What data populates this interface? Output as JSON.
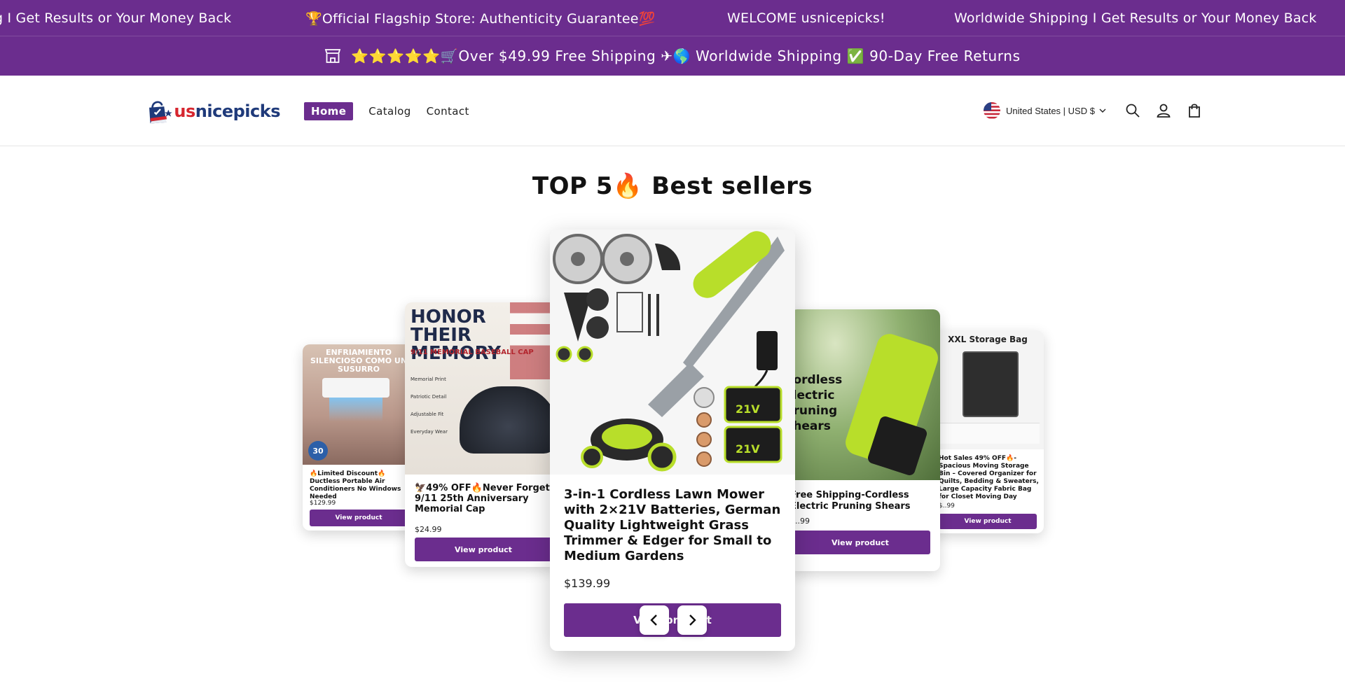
{
  "announcement": {
    "marquee": [
      "g I Get Results or Your Money Back",
      "🏆Official Flagship Store: Authenticity Guarantee💯",
      "WELCOME usnicepicks!",
      "Worldwide Shipping I Get Results or Your Money Back"
    ],
    "sub_text": "⭐⭐⭐⭐⭐🛒Over $49.99 Free Shipping ✈🌎 Worldwide Shipping ✅ 90-Day Free Returns"
  },
  "header": {
    "logo": {
      "us": "us",
      "rest": "nicepicks"
    },
    "nav": [
      "Home",
      "Catalog",
      "Contact"
    ],
    "country": "United States | USD $"
  },
  "section": {
    "title": "TOP 5🔥 Best sellers"
  },
  "products": [
    {
      "title": "🔥Limited Discount🔥Ductless Portable Air Conditioners No Windows Needed",
      "price": "$129.99",
      "button": "View product",
      "img_heading": "ENFRIAMIENTO SILENCIOSO COMO UN SUSURRO",
      "badge": "30"
    },
    {
      "title": "🦅49% OFF🔥Never Forget 9/11 25th Anniversary Memorial Cap",
      "price": "$24.99",
      "button": "View product",
      "img_heading": "HONOR THEIR MEMORY",
      "img_sub": "9/11 MEMORIAL BASEBALL CAP",
      "features": [
        "Memorial Print",
        "Patriotic Detail",
        "Adjustable Fit",
        "Everyday Wear"
      ]
    },
    {
      "title": "3-in-1 Cordless Lawn Mower with 2×21V Batteries, German Quality Lightweight Grass Trimmer & Edger for Small to Medium Gardens",
      "price": "$139.99",
      "button": "View product",
      "battery_label": "21V"
    },
    {
      "title": "Free Shipping-Cordless Electric Pruning Shears",
      "price": "$..99",
      "button": "View product",
      "img_heading": "Cordless Electric Pruning Shears"
    },
    {
      "title": "Hot Sales 49% OFF🔥- Spacious Moving Storage Bin – Covered Organizer for Quilts, Bedding & Sweaters, Large Capacity Fabric Bag for Closet Moving Day",
      "price": "$..99",
      "button": "View product",
      "img_heading": "XXL Storage Bag"
    }
  ],
  "colors": {
    "accent": "#6b2d8e",
    "logo_red": "#d6262f",
    "logo_blue": "#1f3a7a"
  }
}
